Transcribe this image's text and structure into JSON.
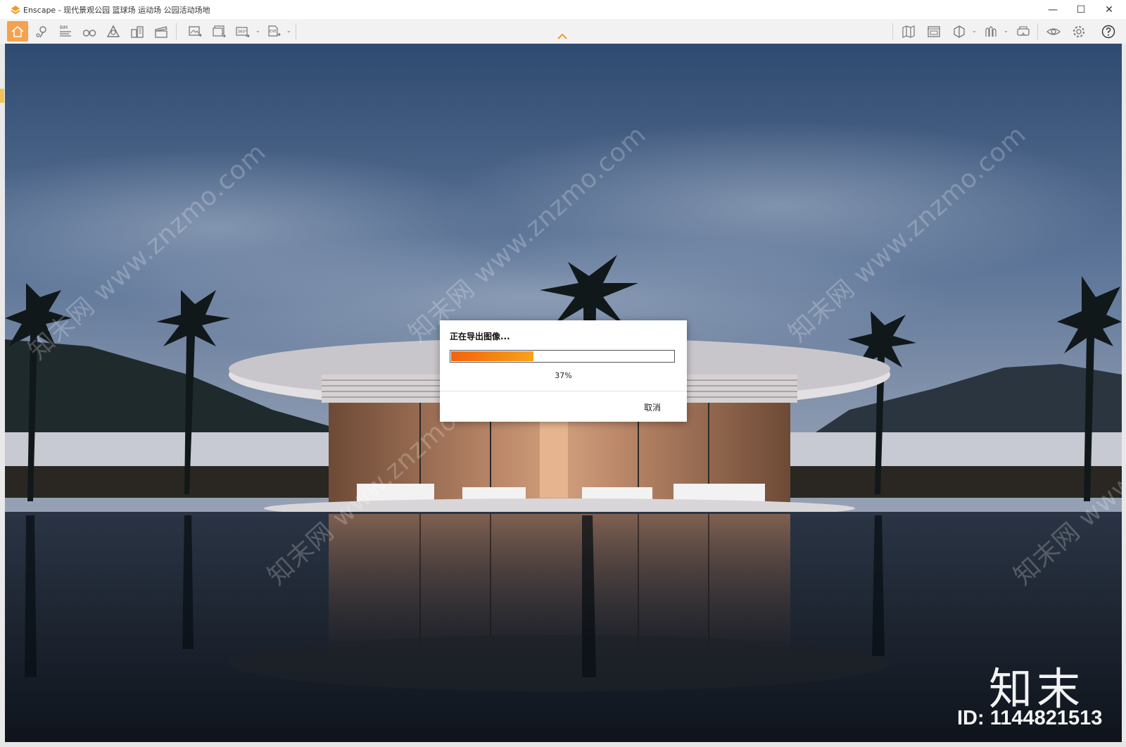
{
  "window": {
    "title": "Enscape - 现代景观公园 篮球场 运动场 公园活动场地",
    "minimize_glyph": "—",
    "maximize_glyph": "☐",
    "close_glyph": "✕"
  },
  "toolbar": {
    "left_tools": [
      {
        "icon": "home-icon",
        "active": true
      },
      {
        "icon": "location-pin-icon"
      },
      {
        "icon": "bim-icon",
        "label": "BIM"
      },
      {
        "icon": "binoculars-icon"
      },
      {
        "icon": "atmosphere-icon"
      },
      {
        "icon": "buildings-icon"
      },
      {
        "icon": "clapper-icon"
      },
      {
        "icon": "screenshot-icon"
      },
      {
        "icon": "batch-render-icon"
      },
      {
        "icon": "panorama-360-icon",
        "label": "360°"
      },
      {
        "icon": "export-exe-icon",
        "label": "EXE"
      }
    ],
    "right_tools": [
      {
        "icon": "map-icon"
      },
      {
        "icon": "window-view-icon"
      },
      {
        "icon": "cube-icon"
      },
      {
        "icon": "asset-library-icon"
      },
      {
        "icon": "vr-headset-icon"
      },
      {
        "icon": "eye-icon"
      },
      {
        "icon": "gear-icon"
      },
      {
        "icon": "help-icon"
      }
    ],
    "accent_color": "#f6a14e"
  },
  "export_dialog": {
    "title": "正在导出图像...",
    "progress": 0.37,
    "percent_text": "37%",
    "cancel_label": "取消",
    "bar_colors": [
      "#f5620c",
      "#f7a21a"
    ]
  },
  "watermark": {
    "text": "知末网 www.znzmo.com",
    "brand": "知末",
    "id_text": "ID: 1144821513"
  }
}
